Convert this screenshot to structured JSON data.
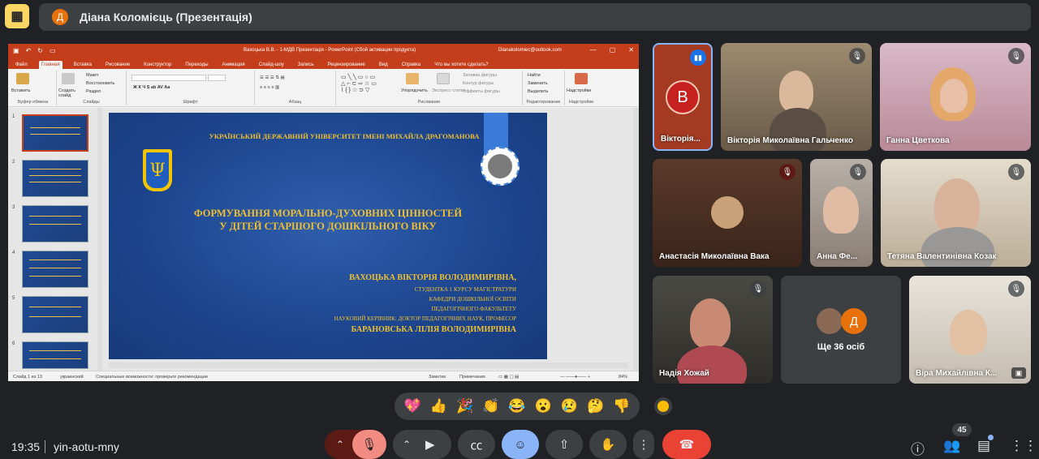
{
  "presenter": {
    "initial": "Д",
    "label": "Діана Коломієць (Презентація)"
  },
  "ppt": {
    "title": "Вахоцька В.В. - 1-МДВ Презентація  -  PowerPoint (Сбой активации продукта)",
    "account": "Dianakolomiec@outlook.com",
    "tabs": [
      "Файл",
      "Главная",
      "Вставка",
      "Рисование",
      "Конструктор",
      "Переходы",
      "Анимация",
      "Слайд-шоу",
      "Запись",
      "Рецензирование",
      "Вид",
      "Справка",
      "Что вы хотите сделать?"
    ],
    "ribbon": {
      "paste": "Вставить",
      "new_slide": "Создать слайд",
      "layout": "Макет",
      "reset": "Восстановить",
      "section": "Раздел",
      "arrange": "Упорядочить",
      "quick_styles": "Экспресс-стили",
      "fill": "Заливка фигуры",
      "outline": "Контур фигуры",
      "effects": "Эффекты фигуры",
      "find": "Найти",
      "replace": "Заменить",
      "select": "Выделить",
      "addins": "Надстройки",
      "groups": [
        "Буфер обмена",
        "Слайды",
        "Шрифт",
        "Абзац",
        "Рисование",
        "Редактирование",
        "Надстройки"
      ]
    },
    "thumb_numbers": [
      "1",
      "2",
      "3",
      "4",
      "5",
      "6"
    ],
    "slide": {
      "university": "УКРАЇНСЬКИЙ ДЕРЖАВНИЙ УНІВЕРСИТЕТ ІМЕНІ МИХАЙЛА ДРАГОМАНОВА",
      "title1": "ФОРМУВАННЯ МОРАЛЬНО-ДУХОВНИХ ЦІННОСТЕЙ",
      "title2": "У ДІТЕЙ СТАРШОГО ДОШКІЛЬНОГО ВІКУ",
      "author": "ВАХОЦЬКА ВІКТОРІЯ ВОЛОДИМИРІВНА,",
      "line1": "СТУДЕНТКА 1 КУРСУ МАГІСТРАТУРИ",
      "line2": "КАФЕДРИ ДОШКІЛЬНОЇ ОСВІТИ",
      "line3": "ПЕДАГОГІЧНОГО ФАКУЛЬТЕТУ",
      "line4": "НАУКОВИЙ КЕРІВНИК: ДОКТОР ПЕДАГОГІЧНИХ НАУК, ПРОФЕСОР",
      "supervisor": "БАРАНОВСЬКА ЛІЛІЯ ВОЛОДИМИРІВНА"
    },
    "status": {
      "slide": "Слайд 1 из 13",
      "lang": "украинский",
      "access": "Специальные возможности: проверьте рекомендации",
      "notes": "Заметки",
      "comments": "Примечания",
      "zoom": "84%"
    }
  },
  "participants": [
    {
      "name": "Вікторія...",
      "initial": "В"
    },
    {
      "name": "Вікторія Миколаївна Гальченко"
    },
    {
      "name": "Ганна Цветкова"
    },
    {
      "name": "Анастасія Миколаївна Вака"
    },
    {
      "name": "Анна Фе..."
    },
    {
      "name": "Тетяна Валентинівна Козак"
    },
    {
      "name": "Надія Хожай"
    },
    {
      "name": "Ще 36 осіб",
      "initial": "Д"
    },
    {
      "name": "Віра Михайлівна К..."
    }
  ],
  "reactions": [
    "💖",
    "👍",
    "🎉",
    "👏",
    "😂",
    "😮",
    "😢",
    "🤔",
    "👎"
  ],
  "bottom": {
    "time": "19:35",
    "meeting_code": "yin-aotu-mny",
    "people_count": "45"
  },
  "icons": {
    "present": "present-to-all-icon",
    "mic": "mic-off-icon",
    "camera": "camera-icon",
    "captions": "captions-icon",
    "emoji": "emoji-icon",
    "present_now": "present-now-icon",
    "hand": "raise-hand-icon",
    "more": "more-vert-icon",
    "hangup": "call-end-icon",
    "info": "info-icon",
    "people": "people-icon",
    "chat": "chat-icon",
    "activities": "apps-icon"
  },
  "colors": {
    "meet_bg": "#202124",
    "tile_bg": "#3c4043",
    "ppt_accent": "#c43e1c",
    "slide_text": "#f0c030",
    "hangup": "#ea4335",
    "active_blue": "#8ab4f8"
  }
}
